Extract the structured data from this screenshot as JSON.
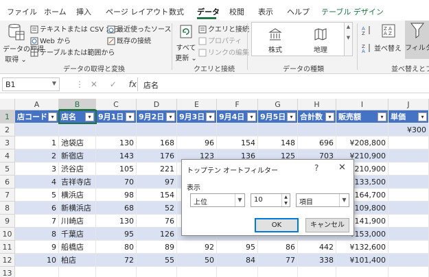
{
  "ribbon_tabs": [
    "ファイル",
    "ホーム",
    "挿入",
    "ページ レイアウト",
    "数式",
    "データ",
    "校閲",
    "表示",
    "ヘルプ",
    "テーブル デザイン"
  ],
  "ribbon": {
    "get_data": "データの取得",
    "from_text_csv": "テキストまたは CSV から",
    "from_web": "Web から",
    "from_table": "テーブルまたは範囲から",
    "recent_sources": "最近使ったソース",
    "existing_connections": "既存の接続",
    "group_get_transform": "データの取得と変換",
    "refresh_all": "すべて",
    "refresh_all_2": "更新",
    "queries_connections": "クエリと接続",
    "properties": "プロパティ",
    "edit_links": "リンクの編集",
    "group_queries": "クエリと接続",
    "data_type_stocks": "株式",
    "data_type_geography": "地理",
    "group_data_types": "データの種類",
    "sort": "並べ替え",
    "filter": "フィルター",
    "group_sort_filter": "並べ替えとフィル"
  },
  "formula_bar": {
    "name_box": "B1",
    "content": "店名"
  },
  "columns": [
    "A",
    "B",
    "C",
    "D",
    "E",
    "F",
    "G",
    "H",
    "I",
    "J"
  ],
  "rows": [
    "1",
    "2",
    "3",
    "4",
    "5",
    "6",
    "7",
    "8",
    "9",
    "10",
    "11",
    "12",
    "13"
  ],
  "table": {
    "headers": [
      "店コード",
      "店名",
      "9月1日",
      "9月2日",
      "9月3日",
      "9月4日",
      "9月5日",
      "合計数",
      "販売額",
      "単価"
    ],
    "row2": {
      "price": "¥300"
    },
    "data": [
      [
        "1",
        "池袋店",
        "130",
        "168",
        "96",
        "154",
        "148",
        "696",
        "¥208,800"
      ],
      [
        "2",
        "新宿店",
        "143",
        "176",
        "123",
        "136",
        "125",
        "703",
        "¥210,900"
      ],
      [
        "3",
        "渋谷店",
        "105",
        "221",
        "",
        "",
        "",
        "",
        "¥210,900"
      ],
      [
        "4",
        "吉祥寺店",
        "70",
        "97",
        "",
        "",
        "",
        "",
        "¥133,500"
      ],
      [
        "5",
        "横浜店",
        "98",
        "154",
        "",
        "",
        "",
        "",
        "¥164,700"
      ],
      [
        "6",
        "新横浜店",
        "68",
        "52",
        "",
        "",
        "",
        "",
        "¥109,800"
      ],
      [
        "7",
        "川崎店",
        "130",
        "76",
        "",
        "",
        "",
        "",
        "¥141,900"
      ],
      [
        "8",
        "千葉店",
        "95",
        "126",
        "",
        "",
        "",
        "",
        "¥153,000"
      ],
      [
        "9",
        "船橋店",
        "80",
        "89",
        "92",
        "95",
        "86",
        "442",
        "¥132,600"
      ],
      [
        "10",
        "柏店",
        "72",
        "55",
        "50",
        "84",
        "77",
        "338",
        "¥101,400"
      ]
    ]
  },
  "dialog": {
    "title": "トップテン オートフィルター",
    "help": "?",
    "close": "✕",
    "section_label": "表示",
    "direction": "上位",
    "count": "10",
    "unit": "項目",
    "ok": "OK",
    "cancel": "キャンセル"
  }
}
